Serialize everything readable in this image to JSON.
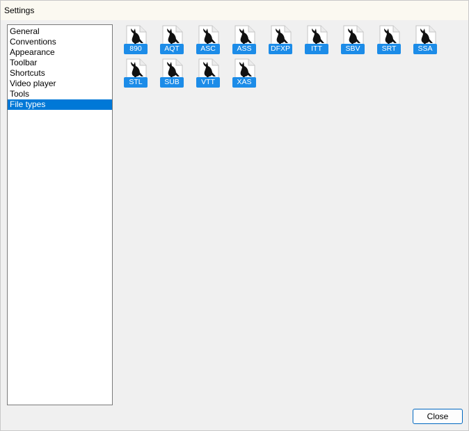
{
  "window": {
    "title": "Settings"
  },
  "sidebar": {
    "items": [
      {
        "label": "General",
        "selected": false
      },
      {
        "label": "Conventions",
        "selected": false
      },
      {
        "label": "Appearance",
        "selected": false
      },
      {
        "label": "Toolbar",
        "selected": false
      },
      {
        "label": "Shortcuts",
        "selected": false
      },
      {
        "label": "Video player",
        "selected": false
      },
      {
        "label": "Tools",
        "selected": false
      },
      {
        "label": "File types",
        "selected": true
      }
    ]
  },
  "file_types": {
    "items": [
      {
        "label": "890",
        "icon": "bird-file-icon"
      },
      {
        "label": "AQT",
        "icon": "bird-file-icon"
      },
      {
        "label": "ASC",
        "icon": "bird-file-icon"
      },
      {
        "label": "ASS",
        "icon": "bird-file-icon"
      },
      {
        "label": "DFXP",
        "icon": "bird-file-icon"
      },
      {
        "label": "ITT",
        "icon": "bird-file-icon"
      },
      {
        "label": "SBV",
        "icon": "bird-file-icon"
      },
      {
        "label": "SRT",
        "icon": "bird-file-icon"
      },
      {
        "label": "SSA",
        "icon": "bird-file-icon"
      },
      {
        "label": "STL",
        "icon": "bird-file-icon"
      },
      {
        "label": "SUB",
        "icon": "bird-file-icon"
      },
      {
        "label": "VTT",
        "icon": "bird-file-icon"
      },
      {
        "label": "XAS",
        "icon": "bird-file-icon"
      }
    ]
  },
  "footer": {
    "close_label": "Close"
  },
  "colors": {
    "selection": "#0078d7",
    "badge": "#1c8ce8",
    "button_border": "#0067c0"
  }
}
